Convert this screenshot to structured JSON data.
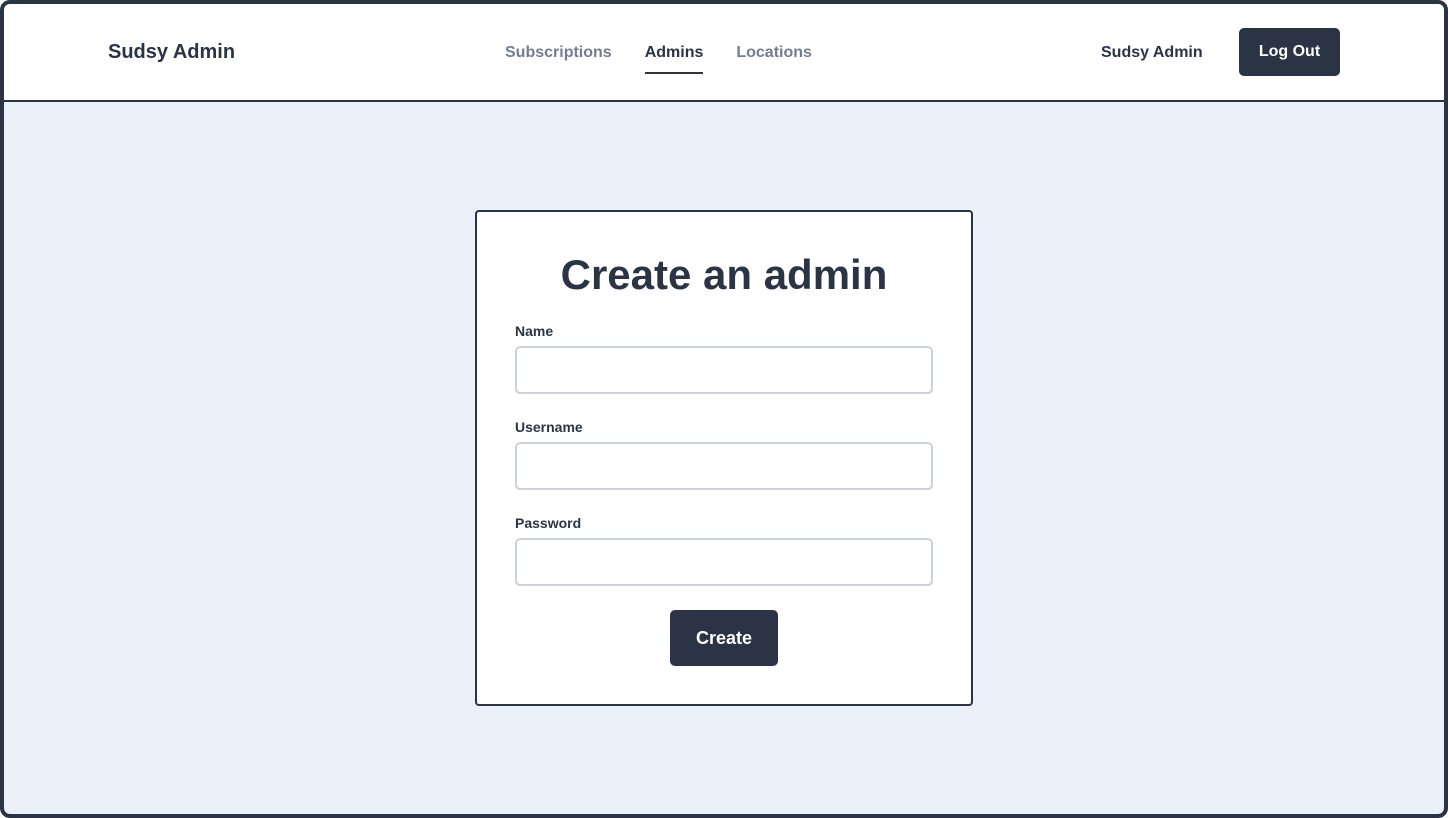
{
  "header": {
    "brand": "Sudsy Admin",
    "nav": [
      {
        "label": "Subscriptions",
        "active": false
      },
      {
        "label": "Admins",
        "active": true
      },
      {
        "label": "Locations",
        "active": false
      }
    ],
    "user_name": "Sudsy Admin",
    "logout_label": "Log Out"
  },
  "form": {
    "title": "Create an admin",
    "fields": [
      {
        "label": "Name",
        "value": "",
        "placeholder": ""
      },
      {
        "label": "Username",
        "value": "",
        "placeholder": ""
      },
      {
        "label": "Password",
        "value": "",
        "placeholder": ""
      }
    ],
    "submit_label": "Create"
  },
  "colors": {
    "primary": "#2b3445",
    "background": "#ecf0f8",
    "muted_text": "#737d8f",
    "input_border": "#cdd2da"
  }
}
